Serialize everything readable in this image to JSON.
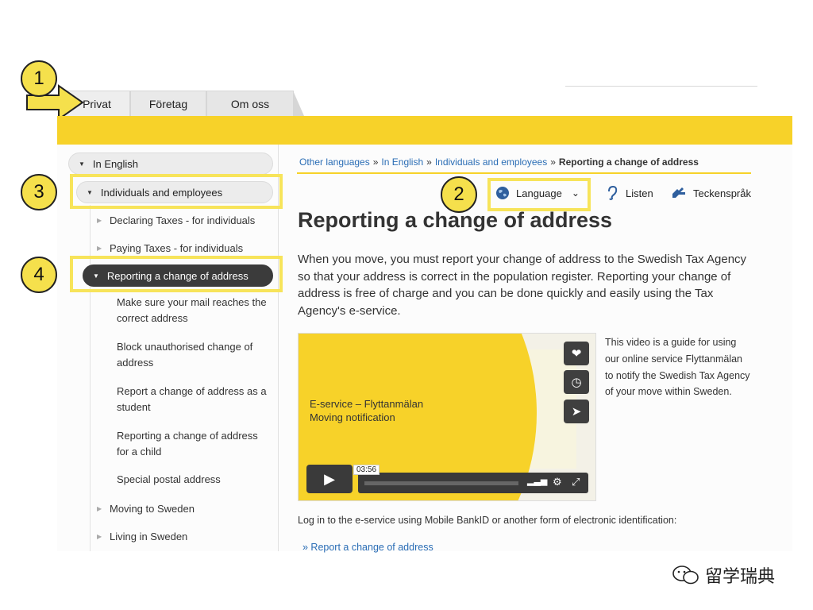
{
  "tabs": [
    {
      "label": "Privat"
    },
    {
      "label": "Företag"
    },
    {
      "label": "Om oss"
    }
  ],
  "annotations": [
    "1",
    "2",
    "3",
    "4"
  ],
  "sidebar": {
    "in_english": "In English",
    "individuals": "Individuals and employees",
    "declaring": "Declaring Taxes - for individuals",
    "paying": "Paying Taxes - for individuals",
    "active": "Reporting a change of address",
    "sub": [
      "Make sure your mail reaches the correct address",
      "Block unauthorised change of address",
      "Report a change of address as a student",
      "Reporting a change of address for a child",
      "Special postal address"
    ],
    "moving": "Moving to Sweden",
    "living": "Living in Sweden"
  },
  "breadcrumb": {
    "items": [
      "Other languages",
      "In English",
      "Individuals and employees"
    ],
    "separator": "»",
    "current": "Reporting a change of address"
  },
  "toolbar": {
    "language": "Language",
    "listen": "Listen",
    "teckensprak": "Teckenspråk"
  },
  "main": {
    "title": "Reporting a change of address",
    "intro": "When you move, you must report your change of address to the Swedish Tax Agency so that your address is correct in the population register. Reporting your change of address is free of charge and you can be done quickly and easily using the Tax Agency's e-service.",
    "video": {
      "title_line1": "E-service – Flyttanmälan",
      "title_line2": "Moving notification",
      "time": "03:56"
    },
    "video_caption": "This video is a guide for using our online service Flyttanmälan to notify the Swedish Tax Agency of your move within Sweden.",
    "login_text": "Log in to the e-service using Mobile BankID or another form of electronic identification:",
    "report_link": "» Report a change of address"
  },
  "watermark": "留学瑞典",
  "colors": {
    "accent_yellow": "#f7d229",
    "link_blue": "#2a6db5",
    "active_dark": "#3b3b3b"
  }
}
